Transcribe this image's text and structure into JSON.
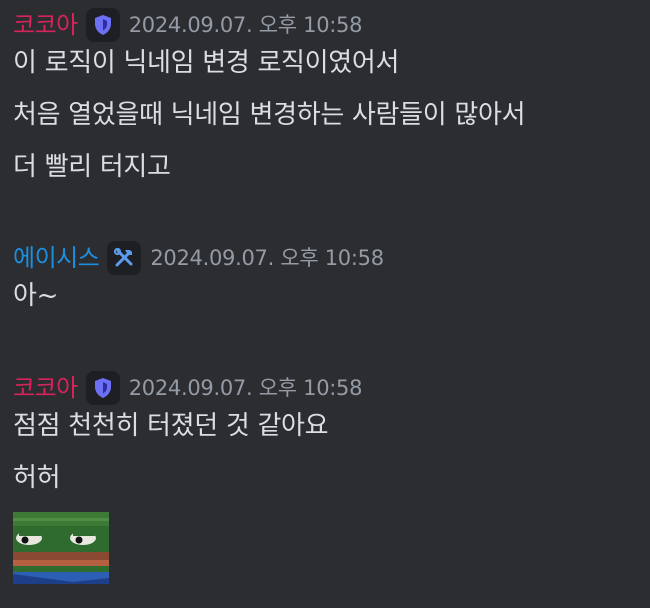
{
  "messages": [
    {
      "author": "코코아",
      "author_color": "#d6245b",
      "badge_icon": "shield-badge-icon",
      "timestamp": "2024.09.07. 오후 10:58",
      "lines": [
        "이 로직이 닉네임 변경 로직이였어서",
        "처음 열었을때 닉네임 변경하는 사람들이 많아서",
        "더 빨리 터지고"
      ]
    },
    {
      "author": "에이시스",
      "author_color": "#1e8ede",
      "badge_icon": "hammer-wrench-badge-icon",
      "timestamp": "2024.09.07. 오후 10:58",
      "lines": [
        "아~"
      ]
    },
    {
      "author": "코코아",
      "author_color": "#d6245b",
      "badge_icon": "shield-badge-icon",
      "timestamp": "2024.09.07. 오후 10:58",
      "lines": [
        "점점 천천히 터졌던 것 같아요",
        "허허"
      ],
      "attachment": "pepe-emoji-image"
    }
  ],
  "colors": {
    "background": "#2b2d31",
    "text": "#dbdee1",
    "timestamp": "#949ba4",
    "shield_badge": "#5865f2"
  }
}
